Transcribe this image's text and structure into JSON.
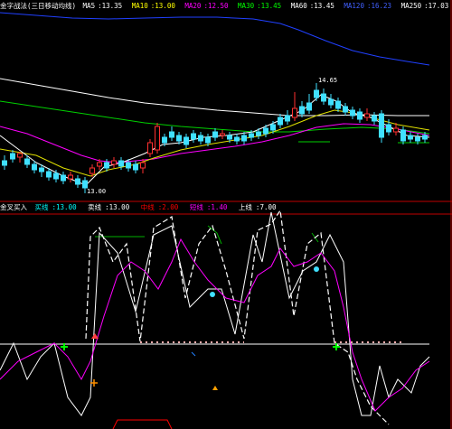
{
  "top_indicator": {
    "title": "金字战法(三日移动均线)",
    "items": [
      {
        "label": "MA5",
        "value": "13.35",
        "color": "#ffffff"
      },
      {
        "label": "MA10",
        "value": "13.00",
        "color": "#ffff00"
      },
      {
        "label": "MA20",
        "value": "12.50",
        "color": "#ff00ff"
      },
      {
        "label": "MA30",
        "value": "13.45",
        "color": "#00ff00"
      },
      {
        "label": "MA60",
        "value": "13.45",
        "color": "#ffffff"
      },
      {
        "label": "MA120",
        "value": "16.23",
        "color": "#0000ff"
      },
      {
        "label": "MA250",
        "value": "17.03",
        "color": "#ffffff"
      }
    ]
  },
  "price_labels": {
    "high": "14.65",
    "low": "13.00"
  },
  "sub_indicator": {
    "title": "金叉买入",
    "items": [
      {
        "label": "买线",
        "value": "13.00",
        "color": "#00ffff"
      },
      {
        "label": "卖线",
        "value": "13.00",
        "color": "#ffffff"
      },
      {
        "label": "中线",
        "value": "2.00",
        "color": "#ff0000"
      },
      {
        "label": "短线",
        "value": "1.40",
        "color": "#ff00ff"
      },
      {
        "label": "上线",
        "value": "7.00",
        "color": "#ffffff"
      }
    ]
  }
}
